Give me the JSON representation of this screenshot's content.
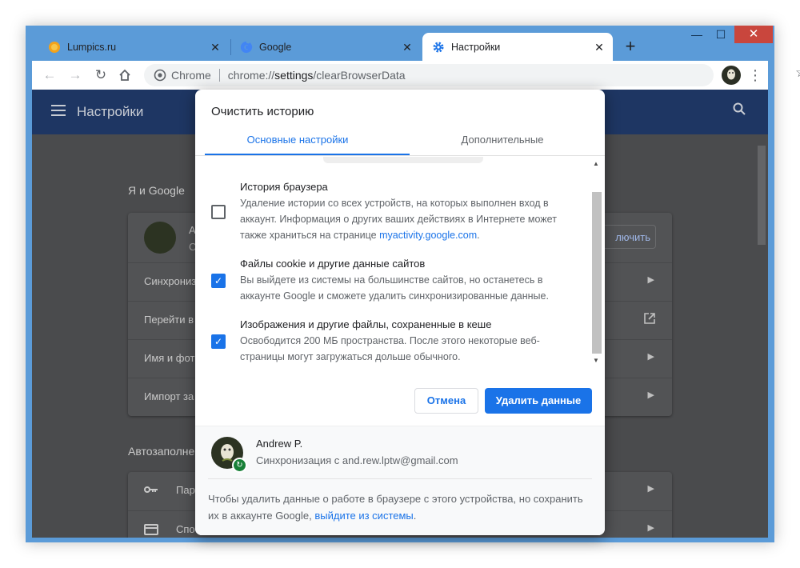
{
  "window": {
    "tabs": [
      {
        "title": "Lumpics.ru",
        "favicon": "orange-circle-icon",
        "active": false
      },
      {
        "title": "Google",
        "favicon": "google-g-icon",
        "active": false
      },
      {
        "title": "Настройки",
        "favicon": "gear-icon",
        "active": true
      }
    ],
    "controls": {
      "minimize": "—",
      "maximize": "☐",
      "close": "✕"
    },
    "new_tab": "+"
  },
  "toolbar": {
    "omnibox_label": "Chrome",
    "url_prefix": "chrome://",
    "url_bold": "settings",
    "url_suffix": "/clearBrowserData"
  },
  "settings_page": {
    "header_title": "Настройки",
    "section_you": "Я и Google",
    "sync_button_partial": "лючить",
    "account_initial": "А",
    "account_line2_partial": "С",
    "rows": [
      "Синхрониз",
      "Перейти в",
      "Имя и фот",
      "Импорт за"
    ],
    "section_autofill": "Автозаполне",
    "autofill_rows": [
      "Пар",
      "Спо"
    ]
  },
  "dialog": {
    "title": "Очистить историю",
    "tabs": [
      "Основные настройки",
      "Дополнительные"
    ],
    "options": [
      {
        "title": "История браузера",
        "description": "Удаление истории со всех устройств, на которых выполнен вход в аккаунт. Информация о других ваших действиях в Интернете может также храниться на странице ",
        "link": "myactivity.google.com",
        "after_link": ".",
        "checked": false
      },
      {
        "title": "Файлы cookie и другие данные сайтов",
        "description": "Вы выйдете из системы на большинстве сайтов, но останетесь в аккаунте Google и сможете удалить синхронизированные данные.",
        "checked": true
      },
      {
        "title": "Изображения и другие файлы, сохраненные в кеше",
        "description": "Освободится 200 МБ пространства. После этого некоторые веб-страницы могут загружаться дольше обычного.",
        "checked": true
      }
    ],
    "buttons": {
      "cancel": "Отмена",
      "delete": "Удалить данные"
    },
    "account": {
      "name": "Andrew P.",
      "sync": "Синхронизация с and.rew.lptw@gmail.com"
    },
    "footer_text": "Чтобы удалить данные о работе в браузере с этого устройства, но сохранить их в аккаунте Google, ",
    "footer_link": "выйдите из системы",
    "footer_after": "."
  },
  "colors": {
    "accent": "#1a73e8",
    "frame": "#5b9bd8",
    "header": "#1e3663"
  }
}
